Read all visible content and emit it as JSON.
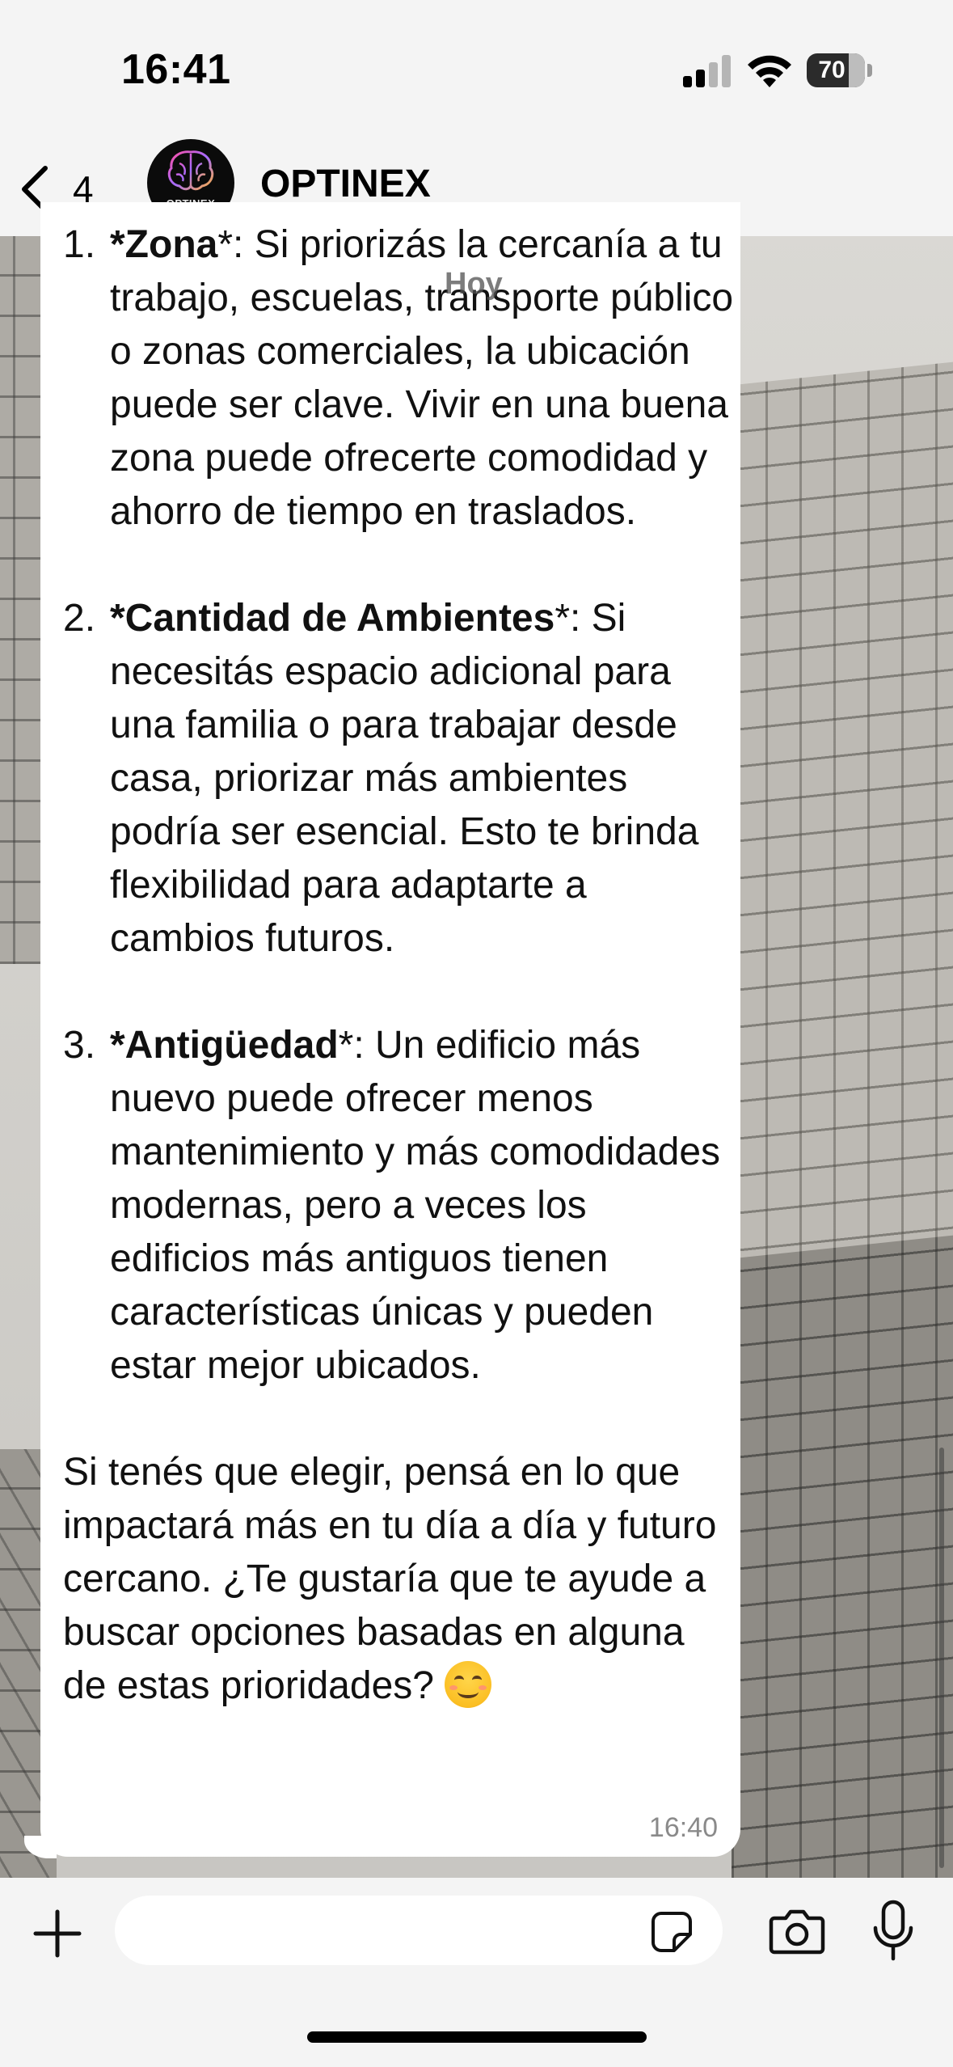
{
  "status_bar": {
    "time": "16:41",
    "battery": "70",
    "signal_bars_active": 2,
    "signal_bars_total": 4
  },
  "header": {
    "back_count": "4",
    "contact_name": "OPTINEX",
    "avatar_label": "OPTINEX"
  },
  "chat": {
    "date_chip": "Hoy",
    "message": {
      "items": [
        {
          "number": "1.",
          "title": "*Zona",
          "text": "*: Si priorizás la cercanía a tu trabajo, escuelas, transporte público o zonas comerciales, la ubicación puede ser clave. Vivir en una buena zona puede ofrecerte comodidad y ahorro de tiempo en traslados."
        },
        {
          "number": "2.",
          "title": "*Cantidad de Ambientes",
          "text": "*: Si necesitás espacio adicional para una familia o para trabajar desde casa, priorizar más ambientes podría ser esencial. Esto te brinda flexibilidad para adaptarte a cambios futuros."
        },
        {
          "number": "3.",
          "title": "*Antigüedad",
          "text": "*: Un edificio más nuevo puede ofrecer menos mantenimiento y más comodidades modernas, pero a veces los edificios más antiguos tienen características únicas y pueden estar mejor ubicados."
        }
      ],
      "closing": "Si tenés que elegir, pensá en lo que impactará más en tu día a día y futuro cercano. ¿Te gustaría que te ayude a buscar opciones basadas en alguna de estas prioridades? ",
      "emoji": "smiling-face-emoji",
      "time": "16:40"
    }
  },
  "input": {
    "value": "",
    "placeholder": ""
  },
  "icons": {
    "back": "chevron-left-icon",
    "plus": "plus-icon",
    "sticker": "sticker-icon",
    "camera": "camera-icon",
    "mic": "microphone-icon"
  },
  "colors": {
    "bubble": "#ffffff",
    "bars": "#f4f4f4",
    "text": "#111111",
    "timestamp": "#8a8a8a"
  }
}
